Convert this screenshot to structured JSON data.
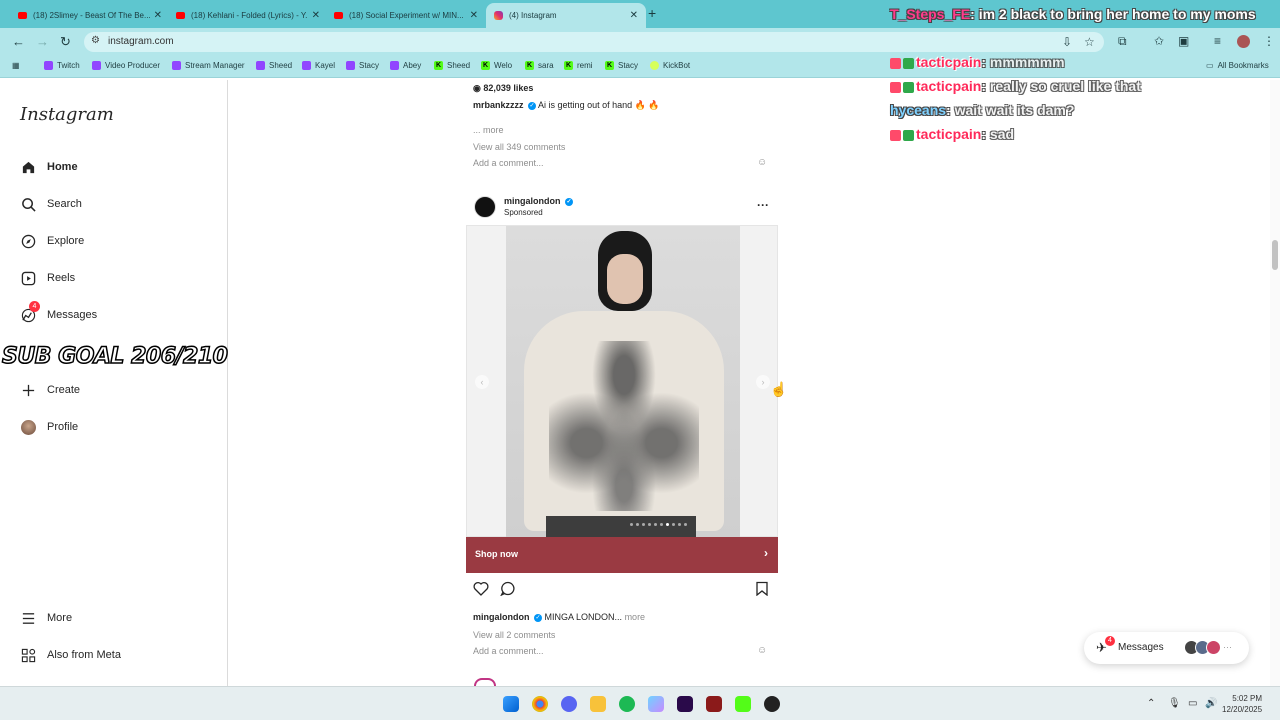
{
  "browser": {
    "tabs": [
      {
        "title": "(18) 2Slimey - Beast Of The Be...",
        "icon": "youtube-icon"
      },
      {
        "title": "(18) Kehlani - Folded (Lyrics) - Y...",
        "icon": "youtube-icon"
      },
      {
        "title": "(18) Social Experiment w/ MIN...",
        "icon": "youtube-icon"
      },
      {
        "title": "(4) Instagram",
        "icon": "instagram-icon"
      }
    ],
    "url": "instagram.com",
    "bookmarks": [
      {
        "label": "Twitch",
        "icon": "twitch-icon"
      },
      {
        "label": "Video Producer",
        "icon": "twitch-icon"
      },
      {
        "label": "Stream Manager",
        "icon": "twitch-icon"
      },
      {
        "label": "Sheed",
        "icon": "twitch-icon"
      },
      {
        "label": "Kayel",
        "icon": "twitch-icon"
      },
      {
        "label": "Stacy",
        "icon": "twitch-icon"
      },
      {
        "label": "Abey",
        "icon": "twitch-icon"
      },
      {
        "label": "Sheed",
        "icon": "kick-icon"
      },
      {
        "label": "Welo",
        "icon": "kick-icon"
      },
      {
        "label": "sara",
        "icon": "kick-icon"
      },
      {
        "label": "remi",
        "icon": "kick-icon"
      },
      {
        "label": "Stacy",
        "icon": "kick-icon"
      },
      {
        "label": "KickBot",
        "icon": "kickbot-icon"
      }
    ],
    "all_bookmarks": "All Bookmarks"
  },
  "instagram": {
    "logo": "Instagram",
    "nav": {
      "home": "Home",
      "search": "Search",
      "explore": "Explore",
      "reels": "Reels",
      "messages": "Messages",
      "messages_badge": "4",
      "create": "Create",
      "profile": "Profile",
      "more": "More",
      "also_from_meta": "Also from Meta"
    },
    "prev_post": {
      "likes": "82,039 likes",
      "user": "mrbankzzzz",
      "caption": "Ai is getting out of hand 🔥 🔥",
      "more": "... more",
      "view_comments": "View all 349 comments",
      "add_comment": "Add a comment..."
    },
    "post": {
      "user": "mingalondon",
      "sponsored": "Sponsored",
      "shop_now": "Shop now",
      "caption_user": "mingalondon",
      "caption": "MINGA LONDON...",
      "more": "more",
      "view_comments": "View all 2 comments",
      "add_comment": "Add a comment..."
    },
    "messages_pill": {
      "label": "Messages",
      "badge": "4"
    }
  },
  "overlay": {
    "sub_goal": "SUB GOAL 206/210",
    "chat": [
      {
        "user": "T_Steps_FE",
        "text": "im 2 black to bring her home to my moms"
      },
      {
        "user": "tacticpain",
        "text": "mmmmmm"
      },
      {
        "user": "tacticpain",
        "text": "really so cruel like that"
      },
      {
        "user": "hyceans",
        "text": "wait wait its dam?"
      },
      {
        "user": "tacticpain",
        "text": "sad"
      }
    ]
  },
  "taskbar": {
    "time": "5:02 PM",
    "date": "12/20/2025"
  }
}
